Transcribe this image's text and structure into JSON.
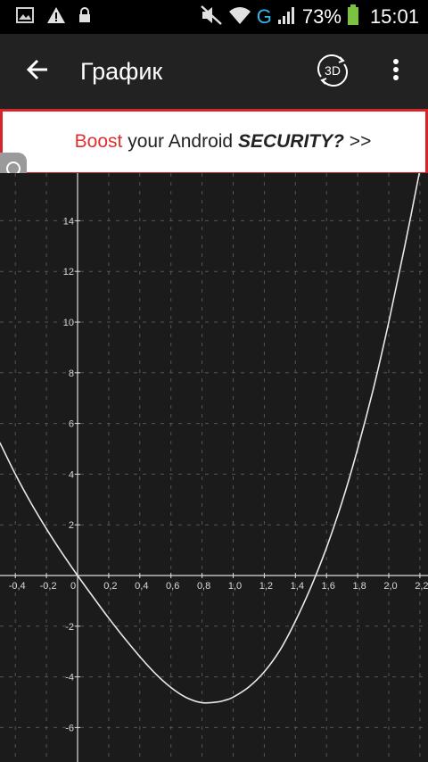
{
  "status_bar": {
    "icons_left": [
      "image-icon",
      "warning-icon",
      "lock-icon"
    ],
    "network": "G",
    "battery_percent": "73%",
    "time": "15:01",
    "icons_right": [
      "mute-icon",
      "wifi-icon",
      "signal-icon",
      "battery-icon"
    ]
  },
  "app_bar": {
    "title": "График",
    "back_icon": "arrow-back-icon",
    "mode_button_label": "3D",
    "menu_icon": "more-vert-icon"
  },
  "ad": {
    "boost": "Boost",
    "middle": " your Android ",
    "security": "SECURITY?",
    "arrows": " >>"
  },
  "colors": {
    "background": "#1b1b1b",
    "app_bar": "#222222",
    "ad_border": "#d6242b",
    "ad_boost": "#e03030",
    "network_letter": "#33b5e5",
    "battery": "#7cc242",
    "curve": "#e8e8e8"
  },
  "chart_data": {
    "type": "line",
    "title": "",
    "xlabel": "",
    "ylabel": "",
    "xlim": [
      -0.5,
      2.23
    ],
    "ylim": [
      -7.3,
      15.9
    ],
    "grid": true,
    "x_ticks": [
      "-0,4",
      "-0,2",
      "0",
      "0,2",
      "0,4",
      "0,6",
      "0,8",
      "1,0",
      "1,2",
      "1,4",
      "1,6",
      "1,8",
      "2,0",
      "2,2"
    ],
    "y_ticks": [
      "-6",
      "-4",
      "-2",
      "0",
      "2",
      "4",
      "6",
      "8",
      "10",
      "12",
      "14"
    ],
    "series": [
      {
        "x": [
          -0.5,
          -0.4,
          -0.3,
          -0.2,
          -0.1,
          0.0,
          0.1,
          0.2,
          0.3,
          0.4,
          0.5,
          0.6,
          0.7,
          0.8,
          0.9,
          0.95,
          1.0,
          1.1,
          1.2,
          1.3,
          1.4,
          1.5,
          1.6,
          1.7,
          1.8,
          1.9,
          2.0,
          2.1,
          2.2
        ],
        "y": [
          5.25,
          4.0,
          2.87,
          1.84,
          0.89,
          0.0,
          -0.85,
          -1.68,
          -2.46,
          -3.2,
          -3.87,
          -4.42,
          -4.82,
          -5.02,
          -4.99,
          -4.92,
          -4.8,
          -4.4,
          -3.8,
          -2.95,
          -1.8,
          -0.45,
          1.1,
          2.9,
          5.0,
          7.35,
          10.0,
          12.9,
          16.0
        ]
      }
    ]
  }
}
